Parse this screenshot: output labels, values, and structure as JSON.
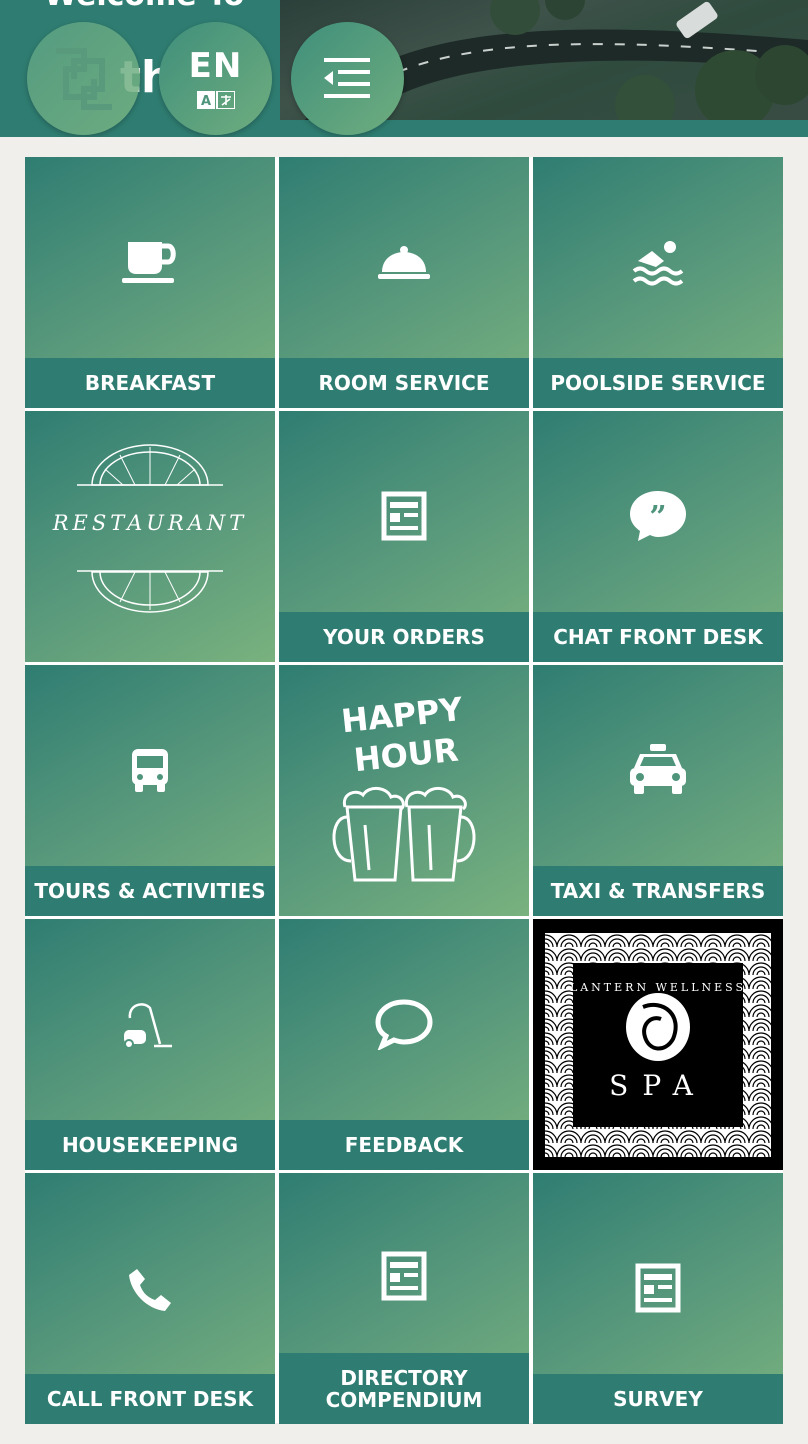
{
  "header": {
    "welcome_text": "Welcome To",
    "hotel_name_partial": "th",
    "language": {
      "code": "EN"
    }
  },
  "tiles": [
    {
      "label": "BREAKFAST",
      "icon": "coffee-cup-icon"
    },
    {
      "label": "ROOM SERVICE",
      "icon": "cloche-icon"
    },
    {
      "label": "POOLSIDE SERVICE",
      "icon": "swimmer-icon"
    },
    {
      "label": "RESTAURANT",
      "icon": "restaurant-emblem"
    },
    {
      "label": "YOUR ORDERS",
      "icon": "newspaper-icon"
    },
    {
      "label": "CHAT FRONT DESK",
      "icon": "quote-bubble-icon"
    },
    {
      "label": "TOURS & ACTIVITIES",
      "icon": "bus-icon"
    },
    {
      "label": "HAPPY HOUR",
      "icon": "beer-mugs-icon"
    },
    {
      "label": "TAXI & TRANSFERS",
      "icon": "taxi-icon"
    },
    {
      "label": "HOUSEKEEPING",
      "icon": "vacuum-cleaner-icon"
    },
    {
      "label": "FEEDBACK",
      "icon": "speech-bubble-icon"
    },
    {
      "label": "LANTERN WELLNESS",
      "sub": "SPA",
      "icon": "spa-logo"
    },
    {
      "label": "CALL FRONT DESK",
      "icon": "phone-icon"
    },
    {
      "label": "DIRECTORY COMPENDIUM",
      "icon": "newspaper-icon"
    },
    {
      "label": "SURVEY",
      "icon": "newspaper-icon"
    }
  ],
  "colors": {
    "primary": "#2f7d72",
    "gradient_end": "#79b27e",
    "background": "#f0efec"
  }
}
